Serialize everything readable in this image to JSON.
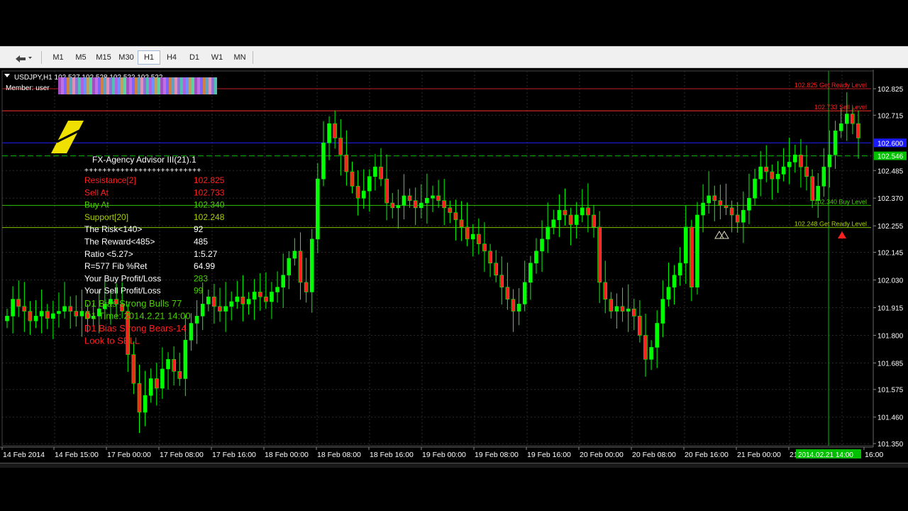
{
  "toolbar": {
    "timeframes": [
      "M1",
      "M5",
      "M15",
      "M30",
      "H1",
      "H4",
      "D1",
      "W1",
      "MN"
    ],
    "active_timeframe": "H1",
    "tool_icon": "chart-tool-icon"
  },
  "chart": {
    "symbol_header": "USDJPY,H1 102.527 102.528 102.522 102.522",
    "member_label": "Member: user",
    "advisor_title": "FX-Agency Advisor III(21).1",
    "advisor_divider": "++++++++++++++++++++++++++",
    "info_rows": [
      {
        "label": "Resistance[2]",
        "value": "102.825",
        "color": "#ff2020"
      },
      {
        "label": "Sell At",
        "value": "102.733",
        "color": "#ff2020"
      },
      {
        "label": "Buy At",
        "value": "102.340",
        "color": "#4cd000"
      },
      {
        "label": "Support[20]",
        "value": "102.248",
        "color": "#a8d000"
      },
      {
        "label": "The Risk<140>",
        "value": "92",
        "color": "#ffffff"
      },
      {
        "label": "The Reward<485>",
        "value": "485",
        "color": "#ffffff"
      },
      {
        "label": "Ratio <5.27>",
        "value": "1:5.27",
        "color": "#ffffff"
      },
      {
        "label": "R=577 Fib %Ret",
        "value": "64.99",
        "color": "#ffffff"
      },
      {
        "label": "Your Buy Profit/Loss",
        "value": "283",
        "color": "#ffffff",
        "value_color": "#4cd000"
      },
      {
        "label": "Your Sell Profit/Loss",
        "value": "99",
        "color": "#ffffff",
        "value_color": "#4cd000"
      }
    ],
    "bias_lines": [
      {
        "text": "D1 Bias Strong Bulls 77",
        "color": "#4cd000"
      },
      {
        "text": "D1 Time: 2014.2.21 14:00",
        "color": "#4cd000"
      },
      {
        "text": "D1 Bias Strong Bears-14",
        "color": "#ff2020"
      },
      {
        "text": "Look to SELL",
        "color": "#ff2020"
      }
    ],
    "level_labels": [
      {
        "text": "102.825 Get Ready Level",
        "color": "#ff2020",
        "price": 102.825
      },
      {
        "text": "102.733 Sell Level",
        "color": "#ff2020",
        "price": 102.733
      },
      {
        "text": "102.340 Buy Level",
        "color": "#4cd000",
        "price": 102.34
      },
      {
        "text": "102.248 Get Ready Level",
        "color": "#a8d000",
        "price": 102.248
      }
    ],
    "price_axis": [
      "102.825",
      "102.715",
      "102.485",
      "102.370",
      "102.255",
      "102.145",
      "102.030",
      "101.915",
      "101.800",
      "101.685",
      "101.575",
      "101.460",
      "101.350"
    ],
    "current_price_tags": [
      {
        "text": "102.600",
        "bg": "#1a1aff",
        "fg": "#ffffff",
        "price": 102.6
      },
      {
        "text": "102.546",
        "bg": "#00c000",
        "fg": "#ffffff",
        "price": 102.546
      }
    ],
    "time_axis": [
      "14 Feb 2014",
      "14 Feb 15:00",
      "17 Feb 00:00",
      "17 Feb 08:00",
      "17 Feb 16:00",
      "18 Feb 00:00",
      "18 Feb 08:00",
      "18 Feb 16:00",
      "19 Feb 00:00",
      "19 Feb 08:00",
      "19 Feb 16:00",
      "20 Feb 00:00",
      "20 Feb 08:00",
      "20 Feb 16:00",
      "21 Feb 00:00",
      "21",
      "16:00"
    ],
    "cursor_time_tag": "2014.02.21 14:00",
    "colors": {
      "bull": "#00ff00",
      "bear": "#ff2020",
      "background": "#000000",
      "grid": "#2a2a2a"
    }
  },
  "chart_data": {
    "type": "candlestick",
    "symbol": "USDJPY",
    "timeframe": "H1",
    "ylim": [
      101.35,
      102.9
    ],
    "closes": [
      101.88,
      101.95,
      101.92,
      101.9,
      101.86,
      101.88,
      101.9,
      101.87,
      101.89,
      101.9,
      101.92,
      101.9,
      101.88,
      101.9,
      101.87,
      101.88,
      101.91,
      101.93,
      101.95,
      101.93,
      101.9,
      101.72,
      101.6,
      101.48,
      101.55,
      101.62,
      101.58,
      101.66,
      101.7,
      101.65,
      101.62,
      101.78,
      101.85,
      101.88,
      101.93,
      101.96,
      101.92,
      101.9,
      101.92,
      101.94,
      101.96,
      101.93,
      101.95,
      101.98,
      101.96,
      101.94,
      101.98,
      102.0,
      102.05,
      102.12,
      102.15,
      102.02,
      101.98,
      102.2,
      102.45,
      102.6,
      102.68,
      102.62,
      102.55,
      102.48,
      102.42,
      102.37,
      102.4,
      102.46,
      102.5,
      102.45,
      102.35,
      102.33,
      102.34,
      102.38,
      102.36,
      102.33,
      102.35,
      102.37,
      102.38,
      102.36,
      102.33,
      102.31,
      102.28,
      102.25,
      102.2,
      102.22,
      102.18,
      102.15,
      102.1,
      102.05,
      102.0,
      101.95,
      101.9,
      101.93,
      102.02,
      102.1,
      102.15,
      102.2,
      102.25,
      102.28,
      102.32,
      102.3,
      102.26,
      102.3,
      102.33,
      102.3,
      102.25,
      102.02,
      101.95,
      101.9,
      101.92,
      101.9,
      101.91,
      101.88,
      101.8,
      101.7,
      101.75,
      101.85,
      101.95,
      102.0,
      102.05,
      102.1,
      102.25,
      102.0,
      102.3,
      102.35,
      102.38,
      102.36,
      102.34,
      102.33,
      102.3,
      102.27,
      102.32,
      102.37,
      102.45,
      102.5,
      102.48,
      102.45,
      102.47,
      102.5,
      102.52,
      102.55,
      102.5,
      102.46,
      102.36,
      102.42,
      102.5,
      102.55,
      102.65,
      102.68,
      102.72,
      102.68,
      102.62
    ]
  }
}
